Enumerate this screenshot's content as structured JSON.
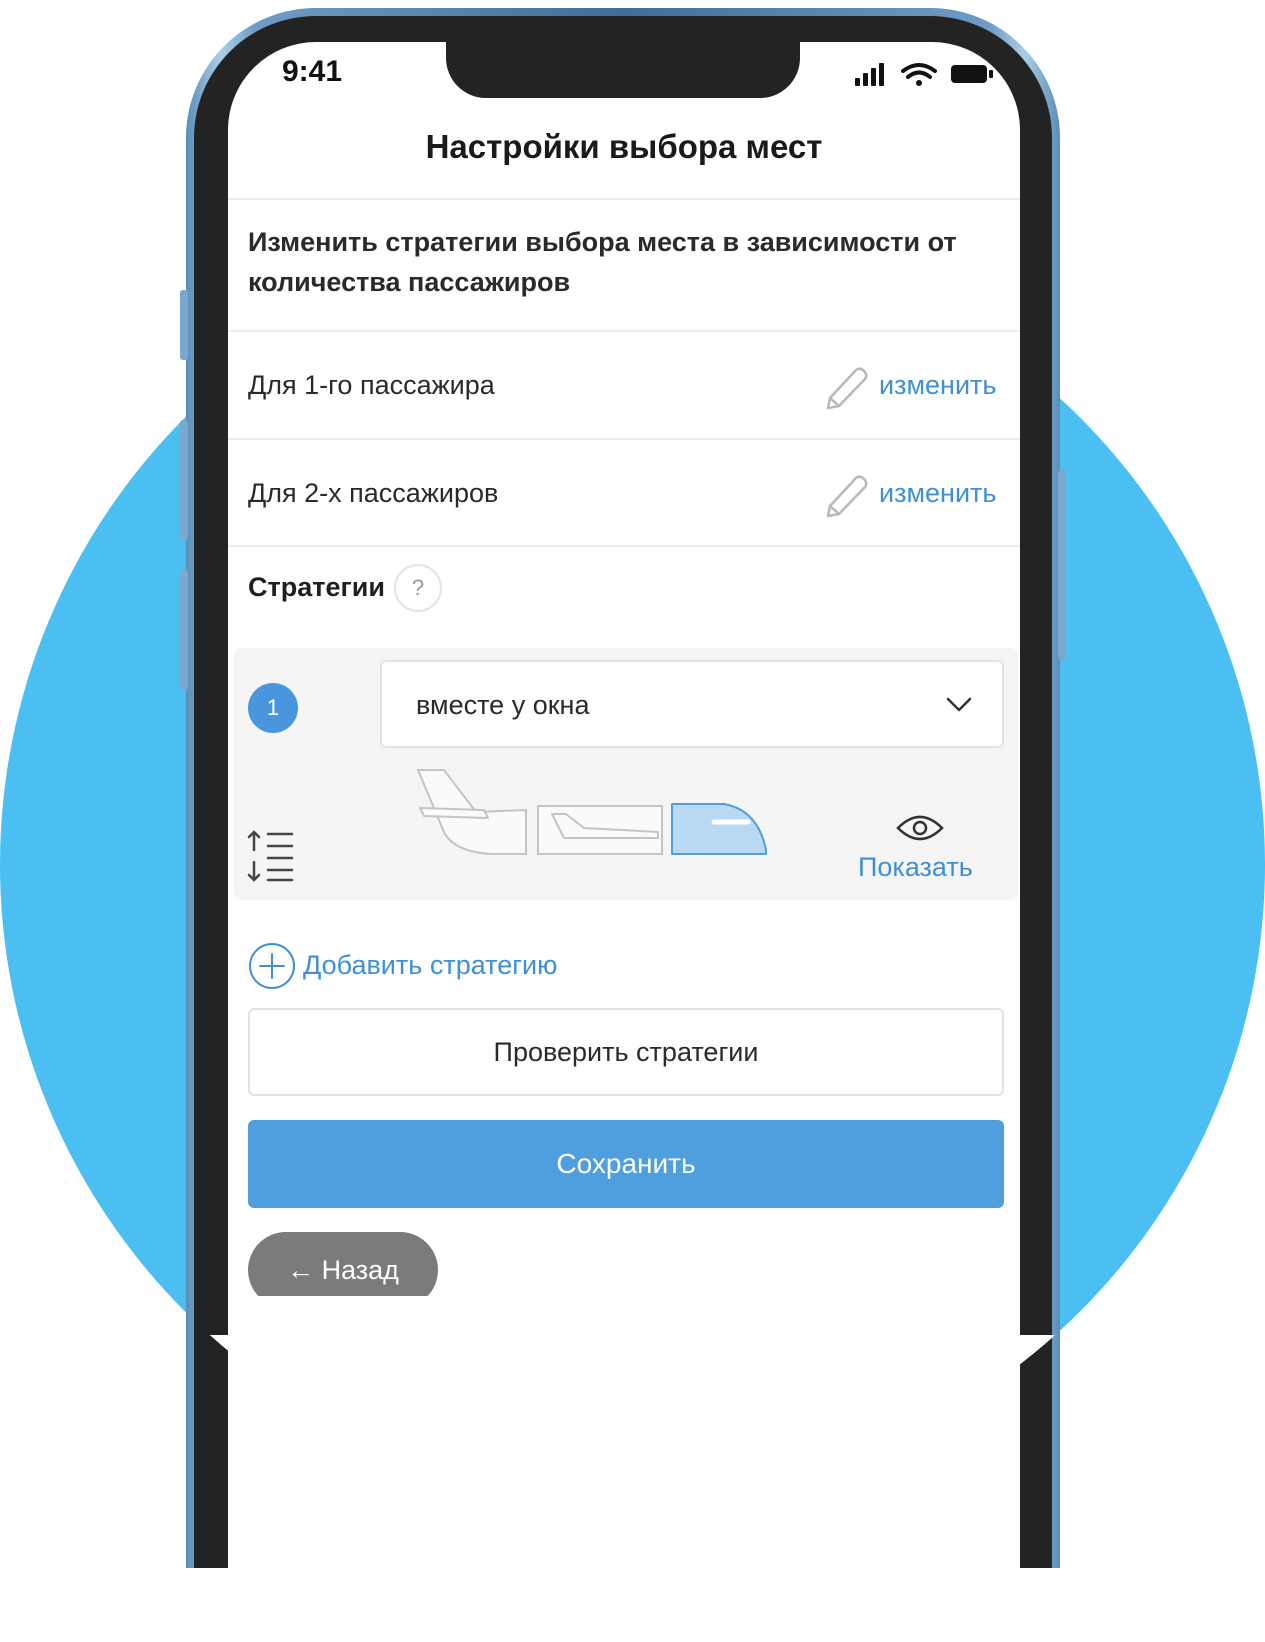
{
  "colors": {
    "background_circle": "#4bbff1",
    "accent": "#4f9ede",
    "link": "#3f8fd8",
    "back_button": "#7b7b7b"
  },
  "status_bar": {
    "time": "9:41",
    "icons": [
      "signal-icon",
      "wifi-icon",
      "battery-icon"
    ]
  },
  "header": {
    "title": "Настройки выбора мест"
  },
  "description": "Изменить стратегии выбора места в зависимости от количества пассажиров",
  "passenger_rows": [
    {
      "label": "Для 1-го пассажира",
      "action": "изменить",
      "icon": "pencil-icon"
    },
    {
      "label": "Для 2-х пассажиров",
      "action": "изменить",
      "icon": "pencil-icon"
    }
  ],
  "strategies": {
    "label": "Стратегии",
    "help": "?",
    "items": [
      {
        "number": "1",
        "selected": "вместе у окна",
        "preview_highlight": "front",
        "show_label": "Показать"
      }
    ],
    "add_label": "Добавить стратегию"
  },
  "buttons": {
    "check": "Проверить стратегии",
    "save": "Сохранить",
    "back": "← Назад"
  }
}
